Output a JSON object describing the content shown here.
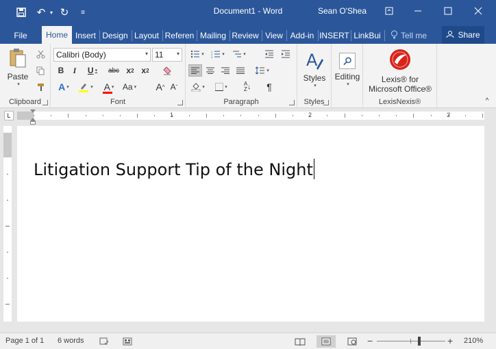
{
  "window": {
    "document_name": "Document1",
    "separator": "-",
    "app_name": "Word",
    "user_name": "Sean O'Shea"
  },
  "tabs": [
    {
      "label": "File"
    },
    {
      "label": "Home"
    },
    {
      "label": "Insert"
    },
    {
      "label": "Design"
    },
    {
      "label": "Layout"
    },
    {
      "label": "Referen"
    },
    {
      "label": "Mailing"
    },
    {
      "label": "Review"
    },
    {
      "label": "View"
    },
    {
      "label": "Add-in"
    },
    {
      "label": "INSERT"
    },
    {
      "label": "LinkBui"
    }
  ],
  "tell_me": "Tell me",
  "share": "Share",
  "ribbon": {
    "clipboard": {
      "label": "Clipboard",
      "paste": "Paste"
    },
    "font": {
      "label": "Font",
      "font_name": "Calibri (Body)",
      "font_size": "11"
    },
    "paragraph": {
      "label": "Paragraph"
    },
    "styles": {
      "label": "Styles",
      "button": "Styles"
    },
    "editing": {
      "button": "Editing"
    },
    "lexis": {
      "label": "LexisNexis®",
      "line1": "Lexis® for",
      "line2": "Microsoft Office®"
    }
  },
  "ruler": {
    "numbers": [
      "1",
      "2",
      "3"
    ]
  },
  "document": {
    "text": "Litigation Support Tip of the Night"
  },
  "status": {
    "page": "Page 1 of 1",
    "words": "6 words",
    "zoom": "210%"
  },
  "colors": {
    "brand": "#2b579a",
    "highlight": "#ffff00",
    "font_color": "#ff0000",
    "lexis_red": "#d9241b"
  }
}
